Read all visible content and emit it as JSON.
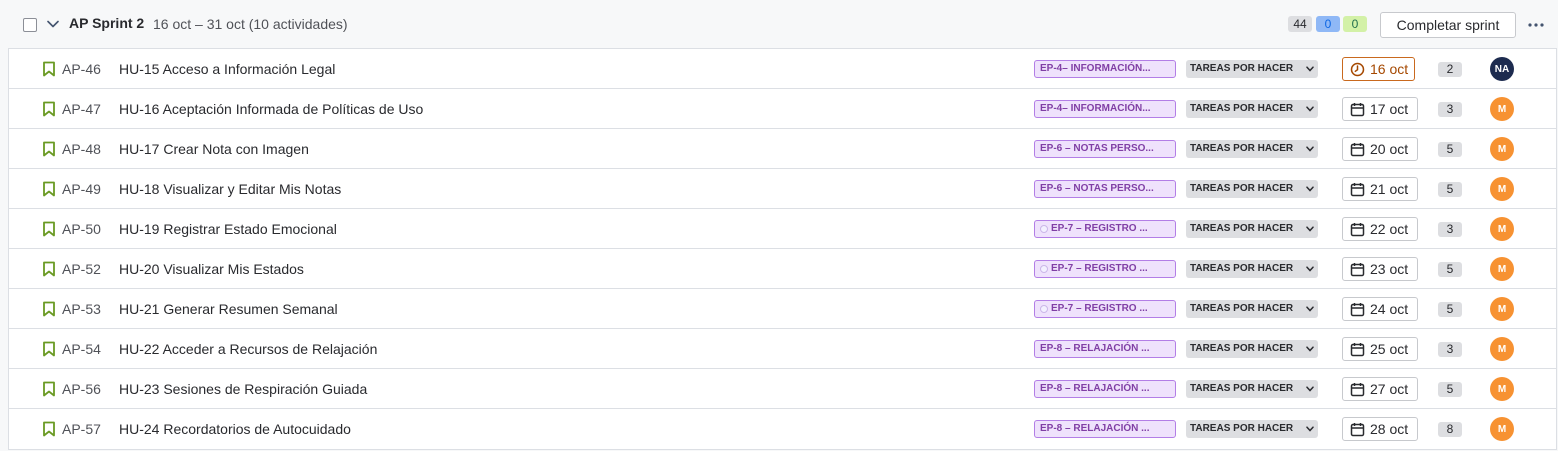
{
  "sprint": {
    "title": "AP Sprint 2",
    "dates": "16 oct – 31 oct (10 actividades)",
    "points_todo": "44",
    "points_in_progress": "0",
    "points_done": "0",
    "complete_label": "Completar sprint"
  },
  "colors": {
    "epic_bg": "#efe2fc",
    "epic_text": "#803fa5",
    "status_bg": "#dddee1",
    "avatar_orange": "#f79232",
    "avatar_navy": "#1d2b4f",
    "bookmark_green": "#6a9a23",
    "overdue": "#c9691e"
  },
  "issues": [
    {
      "key": "AP-46",
      "summary": "HU-15 Acceso a Información Legal",
      "epic": "EP-4– INFORMACIÓN...",
      "epic_emoji": false,
      "status": "TAREAS POR HACER",
      "due": "16 oct",
      "overdue": true,
      "estimate": "2",
      "assignee": "NA",
      "assignee_color": "#1d2b4f"
    },
    {
      "key": "AP-47",
      "summary": "HU-16 Aceptación Informada de Políticas de Uso",
      "epic": "EP-4– INFORMACIÓN...",
      "epic_emoji": false,
      "status": "TAREAS POR HACER",
      "due": "17 oct",
      "overdue": false,
      "estimate": "3",
      "assignee": "M",
      "assignee_color": "#f79232"
    },
    {
      "key": "AP-48",
      "summary": "HU-17 Crear Nota con Imagen",
      "epic": "EP-6 – NOTAS PERSO...",
      "epic_emoji": false,
      "status": "TAREAS POR HACER",
      "due": "20 oct",
      "overdue": false,
      "estimate": "5",
      "assignee": "M",
      "assignee_color": "#f79232"
    },
    {
      "key": "AP-49",
      "summary": "HU-18 Visualizar y Editar Mis Notas",
      "epic": "EP-6 – NOTAS PERSO...",
      "epic_emoji": false,
      "status": "TAREAS POR HACER",
      "due": "21 oct",
      "overdue": false,
      "estimate": "5",
      "assignee": "M",
      "assignee_color": "#f79232"
    },
    {
      "key": "AP-50",
      "summary": "HU-19 Registrar Estado Emocional",
      "epic": "EP-7 – REGISTRO ...",
      "epic_emoji": true,
      "status": "TAREAS POR HACER",
      "due": "22 oct",
      "overdue": false,
      "estimate": "3",
      "assignee": "M",
      "assignee_color": "#f79232"
    },
    {
      "key": "AP-52",
      "summary": "HU-20 Visualizar Mis Estados",
      "epic": "EP-7 – REGISTRO ...",
      "epic_emoji": true,
      "status": "TAREAS POR HACER",
      "due": "23 oct",
      "overdue": false,
      "estimate": "5",
      "assignee": "M",
      "assignee_color": "#f79232"
    },
    {
      "key": "AP-53",
      "summary": "HU-21 Generar Resumen Semanal",
      "epic": "EP-7 – REGISTRO ...",
      "epic_emoji": true,
      "status": "TAREAS POR HACER",
      "due": "24 oct",
      "overdue": false,
      "estimate": "5",
      "assignee": "M",
      "assignee_color": "#f79232"
    },
    {
      "key": "AP-54",
      "summary": "HU-22 Acceder a Recursos de Relajación",
      "epic": "EP-8 – RELAJACIÓN ...",
      "epic_emoji": false,
      "status": "TAREAS POR HACER",
      "due": "25 oct",
      "overdue": false,
      "estimate": "3",
      "assignee": "M",
      "assignee_color": "#f79232"
    },
    {
      "key": "AP-56",
      "summary": "HU-23 Sesiones de Respiración Guiada",
      "epic": "EP-8 – RELAJACIÓN ...",
      "epic_emoji": false,
      "status": "TAREAS POR HACER",
      "due": "27 oct",
      "overdue": false,
      "estimate": "5",
      "assignee": "M",
      "assignee_color": "#f79232"
    },
    {
      "key": "AP-57",
      "summary": "HU-24 Recordatorios de Autocuidado",
      "epic": "EP-8 – RELAJACIÓN ...",
      "epic_emoji": false,
      "status": "TAREAS POR HACER",
      "due": "28 oct",
      "overdue": false,
      "estimate": "8",
      "assignee": "M",
      "assignee_color": "#f79232"
    }
  ]
}
